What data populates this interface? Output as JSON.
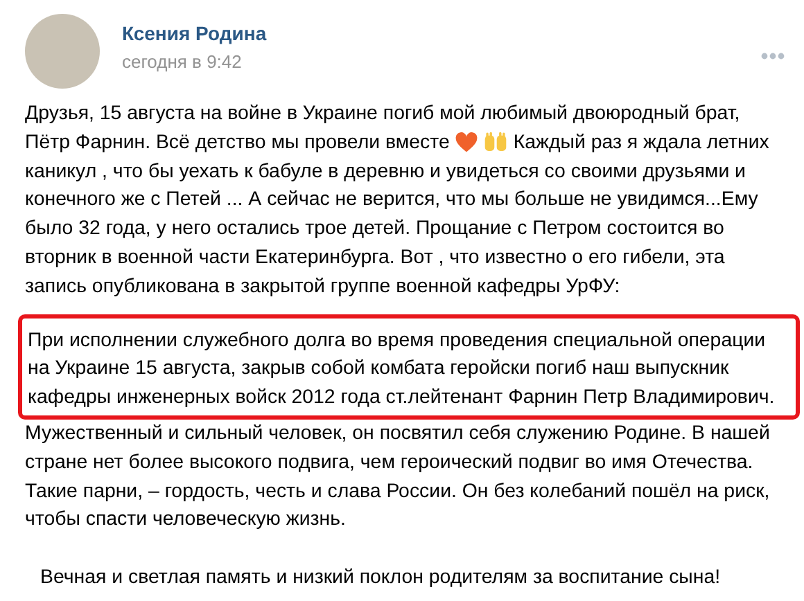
{
  "post": {
    "author": "Ксения Родина",
    "time": "сегодня в 9:42",
    "intro_line": "Друзья, 15 августа на войне в Украине погиб мой любимый двоюродный брат,",
    "intro_before_emoji": "Пётр Фарнин. Всё детство мы провели вместе",
    "intro_after_emoji": "Каждый раз я ждала летних",
    "intro_rest": "каникул , что бы уехать к бабуле в деревню и увидеться со своими друзьями и конечного же с Петей ... А сейчас не верится, что мы больше не увидимся...Ему было 32 года, у него остались трое детей. Прощание с Петром состоится во вторник в военной части Екатеринбурга. Вот , что известно о его гибели, эта запись опубликована в закрытой группе военной кафедры УрФУ:",
    "highlighted_quote": "При исполнении служебного долга во время проведения специальной операции на Украине 15 августа, закрыв собой комбата геройски погиб наш выпускник кафедры инженерных войск 2012 года ст.лейтенант Фарнин Петр Владимирович.",
    "continuation": "Мужественный и сильный человек, он посвятил себя служению Родине. В нашей стране нет более высокого подвига, чем героический подвиг во имя Отечества. Такие парни, – гордость, честь и слава России.  Он без колебаний пошёл на риск, чтобы спасти человеческую жизнь.",
    "closing": "Вечная и светлая память и низкий поклон родителям за воспитание сына!"
  }
}
